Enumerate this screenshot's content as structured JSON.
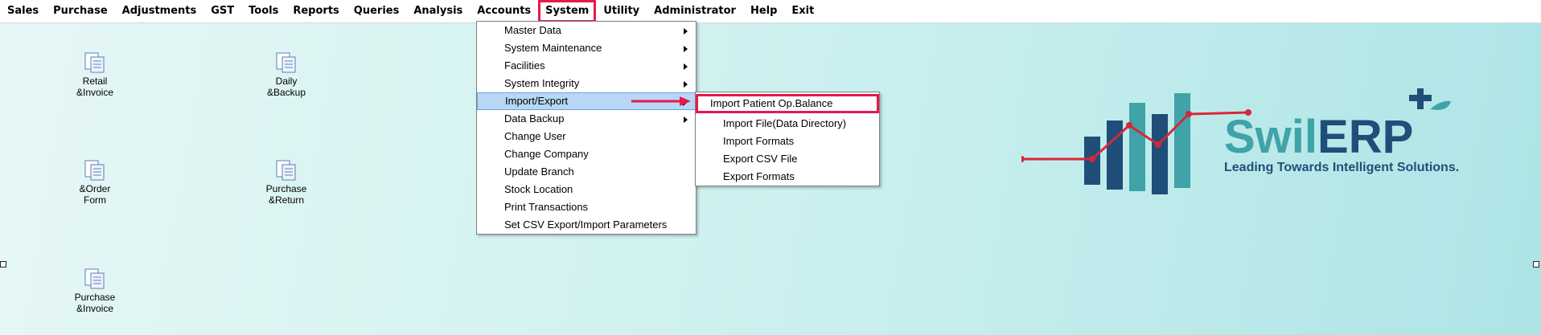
{
  "menu": [
    "Sales",
    "Purchase",
    "Adjustments",
    "GST",
    "Tools",
    "Reports",
    "Queries",
    "Analysis",
    "Accounts",
    "System",
    "Utility",
    "Administrator",
    "Help",
    "Exit"
  ],
  "desktop_icons": {
    "retail_invoice": "Retail\n&Invoice",
    "daily_backup": "Daily\n&Backup",
    "order_form": "&Order\nForm",
    "purchase_return": "Purchase\n&Return",
    "purchase_invoice": "Purchase\n&Invoice"
  },
  "system_menu": [
    {
      "label": "Master Data",
      "submenu": true
    },
    {
      "label": "System Maintenance",
      "submenu": true
    },
    {
      "label": "Facilities",
      "submenu": true
    },
    {
      "label": "System Integrity",
      "submenu": true
    },
    {
      "label": "Import/Export",
      "submenu": true,
      "highlighted": true
    },
    {
      "label": "Data Backup",
      "submenu": true
    },
    {
      "label": "Change User",
      "submenu": false
    },
    {
      "label": "Change Company",
      "submenu": false
    },
    {
      "label": "Update Branch",
      "submenu": false
    },
    {
      "label": "Stock Location",
      "submenu": false
    },
    {
      "label": "Print Transactions",
      "submenu": false
    },
    {
      "label": "Set CSV Export/Import Parameters",
      "submenu": false
    }
  ],
  "import_export_menu": [
    "Import Patient Op.Balance",
    "Import File(Data Directory)",
    "Import Formats",
    "Export CSV File",
    "Export Formats"
  ],
  "logo": {
    "name_part1": "Swil",
    "name_part2": "ERP",
    "tagline": "Leading Towards Intelligent Solutions."
  },
  "colors": {
    "accent_highlight": "#e6194b",
    "menu_hover": "#b7d7f5",
    "logo_teal": "#3fa3a8",
    "logo_navy": "#1f4e79",
    "logo_red": "#d62839"
  }
}
